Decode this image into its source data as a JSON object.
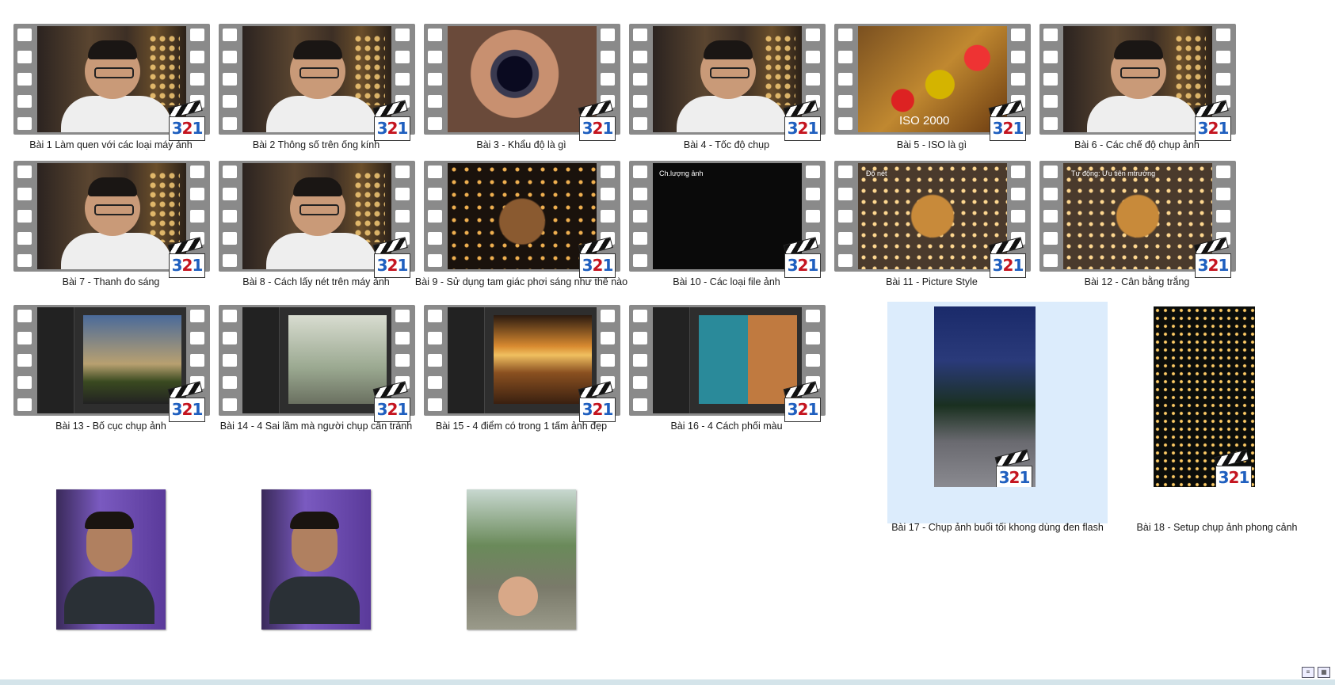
{
  "items": [
    {
      "label": "Bài 1 Làm quen với các loại máy ảnh",
      "type": "film",
      "scene": "man"
    },
    {
      "label": "Bài 2 Thông số trên ống kính",
      "type": "film",
      "scene": "man"
    },
    {
      "label": "Bài 3 - Khẩu độ là gì",
      "type": "film",
      "scene": "lens"
    },
    {
      "label": "Bài 4 - Tốc độ chụp",
      "type": "film",
      "scene": "man"
    },
    {
      "label": "Bài 5 - ISO là gì",
      "type": "film",
      "scene": "flowers",
      "overlay": "ISO 2000"
    },
    {
      "label": "Bài 6 - Các chế độ chụp ảnh",
      "type": "film",
      "scene": "man"
    },
    {
      "label": "Bài 7 - Thanh đo sáng",
      "type": "film",
      "scene": "man"
    },
    {
      "label": "Bài 8 - Cách lấy nét trên máy ảnh",
      "type": "film",
      "scene": "man"
    },
    {
      "label": "Bài 9 - Sử dụng tam giác phơi sáng như thế nào",
      "type": "film",
      "scene": "dark"
    },
    {
      "label": "Bài 10 - Các loại file ảnh",
      "type": "film",
      "scene": "camui",
      "overlay": "Ch.lượng ảnh"
    },
    {
      "label": "Bài 11 - Picture Style",
      "type": "film",
      "scene": "toy",
      "overlay": "Độ nét"
    },
    {
      "label": "Bài 12 - Cân bằng trắng",
      "type": "film",
      "scene": "toy",
      "overlay": "Tự động: Ưu tiên mtrường"
    },
    {
      "label": "Bài 13 - Bố cục chụp ảnh",
      "type": "film",
      "scene": "editor-tree"
    },
    {
      "label": "Bài 14 - 4 Sai lầm mà người chụp cần tránh",
      "type": "film",
      "scene": "editor-girl"
    },
    {
      "label": "Bài 15 - 4 điểm có trong 1 tấm ảnh đẹp",
      "type": "film",
      "scene": "editor-sunset"
    },
    {
      "label": "Bài 16 - 4 Cách phối màu",
      "type": "film",
      "scene": "editor-collage"
    },
    {
      "label": "Bài 17 - Chụp ảnh buổi tối khong dùng đen flash",
      "type": "portrait",
      "scene": "night",
      "selected": true
    },
    {
      "label": "Bài 18 - Setup chụp ảnh phong cảnh",
      "type": "portrait",
      "scene": "black"
    },
    {
      "label": "",
      "type": "plain",
      "scene": "man2"
    },
    {
      "label": "",
      "type": "plain",
      "scene": "man2"
    },
    {
      "label": "",
      "type": "plain",
      "scene": "street"
    }
  ],
  "badge": {
    "digits": [
      "3",
      "2",
      "1"
    ]
  },
  "statusbar": {
    "details_view": "≡",
    "icons_view": "▦"
  }
}
